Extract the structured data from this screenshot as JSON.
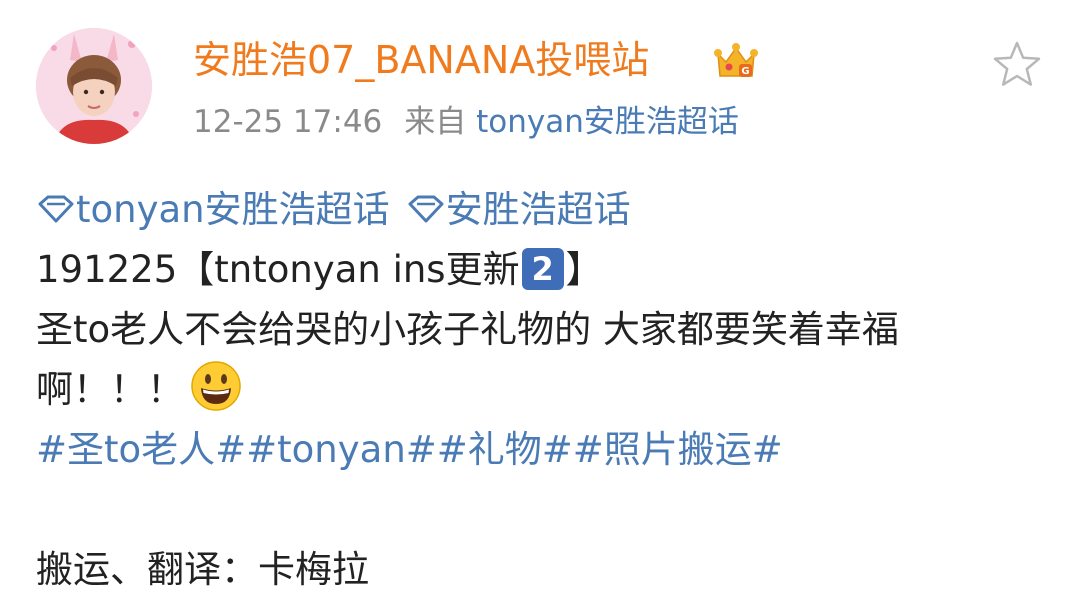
{
  "post": {
    "author": "安胜浩07_BANANA投喂站",
    "timestamp": "12-25 17:46",
    "source_prefix": "来自",
    "source": "tonyan安胜浩超话",
    "topics": [
      "tonyan安胜浩超话",
      "安胜浩超话"
    ],
    "line1_prefix": "191225【tntonyan ins更新",
    "line1_badge": "2",
    "line1_suffix": "】",
    "line2": "圣to老人不会给哭的小孩子礼物的 大家都要笑着幸福",
    "line3": "啊！！！",
    "hashtags": [
      "#圣to老人#",
      "#tonyan#",
      "#礼物#",
      "#照片搬运#"
    ],
    "credit": "搬运、翻译：卡梅拉"
  },
  "icons": {
    "author_badge": "crown-badge-icon",
    "favorite": "star-outline-icon",
    "topic": "diamond-icon",
    "emoji": "grinning-face-icon"
  },
  "colors": {
    "author": "#f07b1e",
    "link": "#4a7bb5",
    "meta": "#8a8a8a",
    "badge": "#3f6db8"
  }
}
